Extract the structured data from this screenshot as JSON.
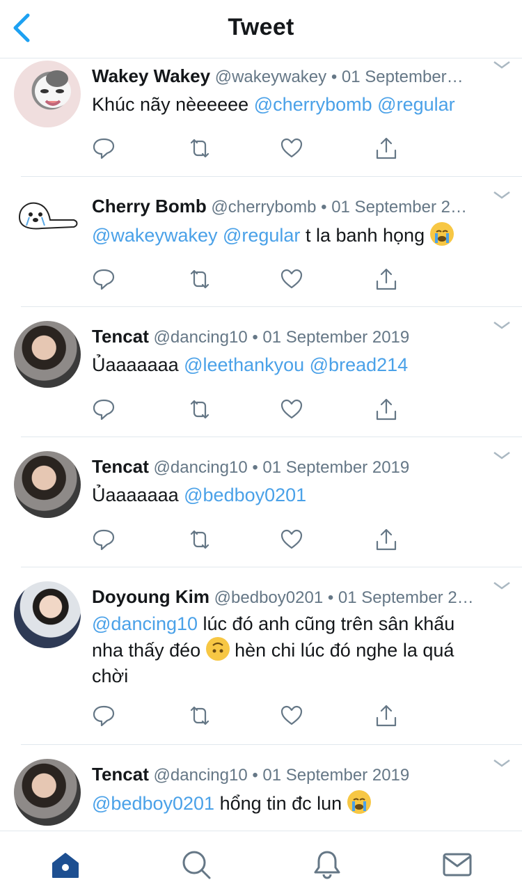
{
  "header": {
    "title": "Tweet"
  },
  "colors": {
    "accent": "#1da1f2",
    "mention": "#4aa1e8",
    "text": "#14171a",
    "muted": "#657786",
    "divider": "#e1e8ed"
  },
  "tweets": [
    {
      "name": "Wakey Wakey",
      "meta": "@wakeywakey • 01 September…",
      "line1_mention": "",
      "line1_text": "Khúc nãy nèeeeee ",
      "line1_mention2": "@cherrybomb @regular",
      "extra": ""
    },
    {
      "name": "Cherry Bomb",
      "meta": "@cherrybomb • 01 September 2…",
      "line1_mention": "@wakeywakey @regular",
      "line1_text": " t la banh họng ",
      "emoji": "loudly-crying-face"
    },
    {
      "name": "Tencat",
      "meta": "@dancing10 • 01 September 2019",
      "line1_text": "Ủaaaaaaa ",
      "line1_mention2": "@leethankyou @bread214"
    },
    {
      "name": "Tencat",
      "meta": "@dancing10 • 01 September 2019",
      "line1_text": "Ủaaaaaaa ",
      "line1_mention2": "@bedboy0201"
    },
    {
      "name": "Doyoung Kim",
      "meta": "@bedboy0201 • 01 September 2…",
      "line1_mention": "@dancing10",
      "line1_text": " lúc đó anh cũng trên sân khấu",
      "line2_text_a": "nha thấy đéo ",
      "line2_text_b": " hèn chi lúc đó nghe la quá",
      "line3_text": "chời",
      "emoji": "upside-down-face"
    },
    {
      "name": "Tencat",
      "meta": "@dancing10 • 01 September 2019",
      "line1_mention": "@bedboy0201",
      "line1_text": " hổng tin đc lun ",
      "emoji": "loudly-crying-face"
    }
  ],
  "tabbar": {
    "items": [
      "home-icon",
      "search-icon",
      "bell-icon",
      "mail-icon"
    ],
    "active": "home-icon"
  }
}
